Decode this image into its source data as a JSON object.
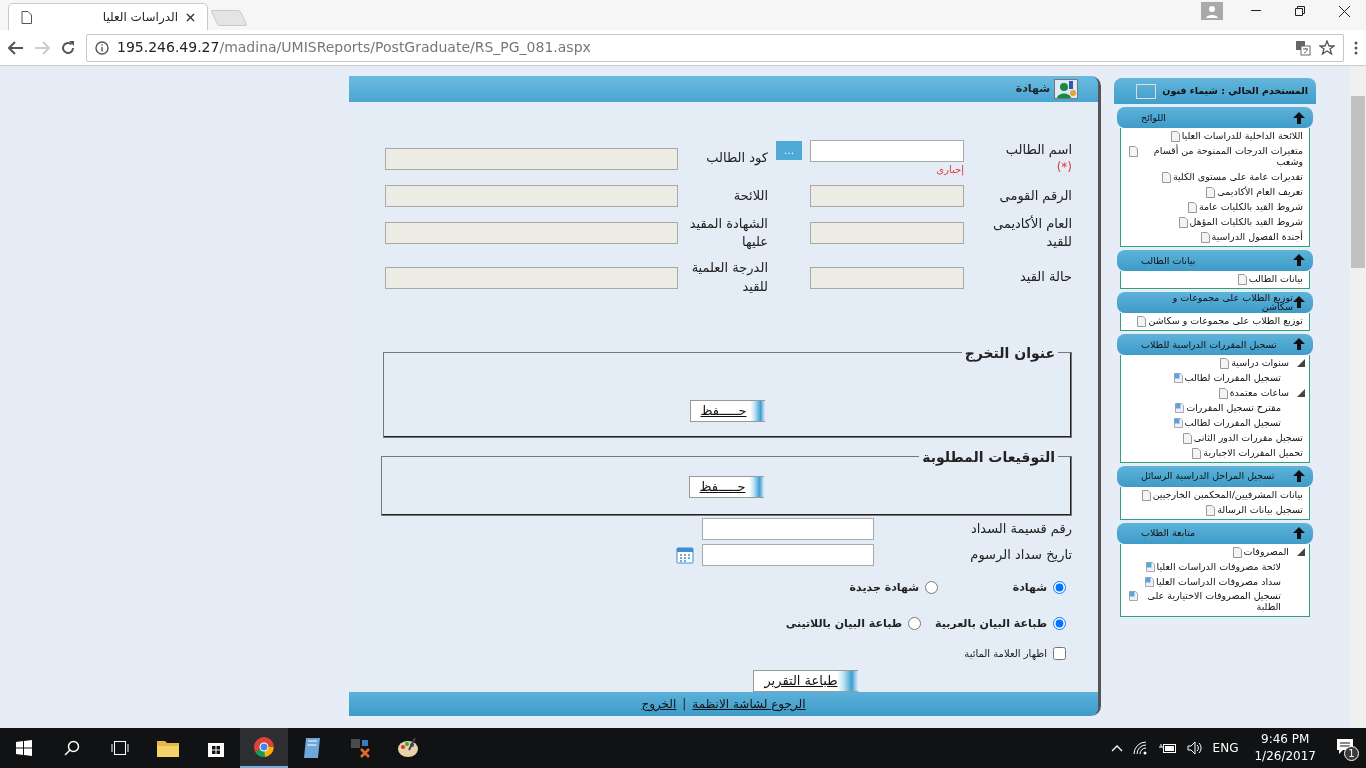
{
  "browser": {
    "tab_title": "الدراسات العليا",
    "url_host": "195.246.49.27",
    "url_path": "/madina/UMISReports/PostGraduate/RS_PG_081.aspx"
  },
  "sidebar": {
    "user": "المستخدم الحالي : شيماء فنون",
    "sections": [
      {
        "title": "اللوائح",
        "expanded": true,
        "items": [
          {
            "label": "اللائحة الداخلية للدراسات العليا"
          },
          {
            "label": "متغيرات الدرجات الممنوحة من أقسام وشعب"
          },
          {
            "label": "تقديرات عامة على مستوى الكلية"
          },
          {
            "label": "تعريف العام الأكاديمى"
          },
          {
            "label": "شروط القيد بالكليات عامة"
          },
          {
            "label": "شروط القيد بالكليات المؤهل"
          },
          {
            "label": "أجندة الفصول الدراسية"
          }
        ]
      },
      {
        "title": "بيانات الطالب",
        "expanded": true,
        "items": [
          {
            "label": "بيانات الطالب"
          }
        ]
      },
      {
        "title": "توزيع الطلاب على مجموعات و سكاشن",
        "expanded": true,
        "items": [
          {
            "label": "توزيع الطلاب على مجموعات و سكاشن"
          }
        ]
      },
      {
        "title": "تسجيل المقررات الدراسية للطلاب",
        "expanded": true,
        "items": [
          {
            "label": "سنوات دراسية",
            "expanded": true,
            "children": [
              {
                "label": "تسجيل المقررات لطالب"
              }
            ]
          },
          {
            "label": "ساعات معتمدة",
            "expanded": true,
            "children": [
              {
                "label": "مقترح تسجيل المقررات"
              },
              {
                "label": "تسجيل المقررات لطالب"
              }
            ]
          },
          {
            "label": "تسجيل مقررات الدور الثانى"
          },
          {
            "label": "تحميل المقررات الاجبارية"
          }
        ]
      },
      {
        "title": "تسجيل المراحل الدراسية الرسائل",
        "expanded": true,
        "items": [
          {
            "label": "بيانات المشرفيين/المحكمين الخارجيين"
          },
          {
            "label": "تسجيل بيانات الرسالة"
          }
        ]
      },
      {
        "title": "متابعة الطلاب",
        "expanded": true,
        "items": [
          {
            "label": "المصروفات",
            "expanded": true,
            "children": [
              {
                "label": "لائحة مصروفات الدراسات العليا"
              },
              {
                "label": "سداد مصروفات الدراسات العليا"
              },
              {
                "label": "تسجيل المصروفات الاختيارية على الطلبة"
              }
            ]
          }
        ]
      }
    ]
  },
  "form": {
    "title": "شهادة",
    "rows": [
      [
        {
          "label": "اسم الطالب",
          "required_mark": "(*)",
          "hint": "إجبارى",
          "kind": "lookup",
          "button": "..."
        },
        {
          "label": "كود الطالب",
          "kind": "readonly"
        }
      ],
      [
        {
          "label": "الرقم القومى",
          "kind": "readonly"
        },
        {
          "label": "اللائحة",
          "kind": "readonly"
        }
      ],
      [
        {
          "label": "العام الأكاديمى للقيد",
          "kind": "readonly"
        },
        {
          "label": "الشهادة المقيد عليها",
          "kind": "readonly"
        }
      ],
      [
        {
          "label": "حالة القيد",
          "kind": "readonly"
        },
        {
          "label": "الدرجة العلمية للقيد",
          "kind": "readonly"
        }
      ]
    ],
    "fieldsets": [
      {
        "legend": "عنوان التخرج",
        "button": "حـــــفظ"
      },
      {
        "legend": "التوقيعات المطلوبة",
        "button": "حـــــفظ"
      }
    ],
    "payment_fields": [
      {
        "label": "رقم قسيمة السداد",
        "kind": "text"
      },
      {
        "label": "تاريخ سداد الرسوم",
        "kind": "date"
      }
    ],
    "radio_groups": [
      {
        "options": [
          {
            "label": "شهادة",
            "selected": true
          },
          {
            "label": "شهادة جديدة",
            "selected": false
          }
        ]
      },
      {
        "options": [
          {
            "label": "طباعة البيان بالعربية",
            "selected": true
          },
          {
            "label": "طباعة البيان باللاتينى",
            "selected": false
          }
        ]
      }
    ],
    "checkbox": {
      "label": "اظهار العلامة المائية",
      "checked": false
    },
    "print_button": "طباعة التقرير",
    "footer_links": [
      "الرجوع لشاشة الانظمة",
      "الخروج"
    ],
    "footer_separator": "|"
  },
  "taskbar": {
    "language": "ENG",
    "time": "9:46 PM",
    "date": "1/26/2017",
    "notifications": "1"
  }
}
